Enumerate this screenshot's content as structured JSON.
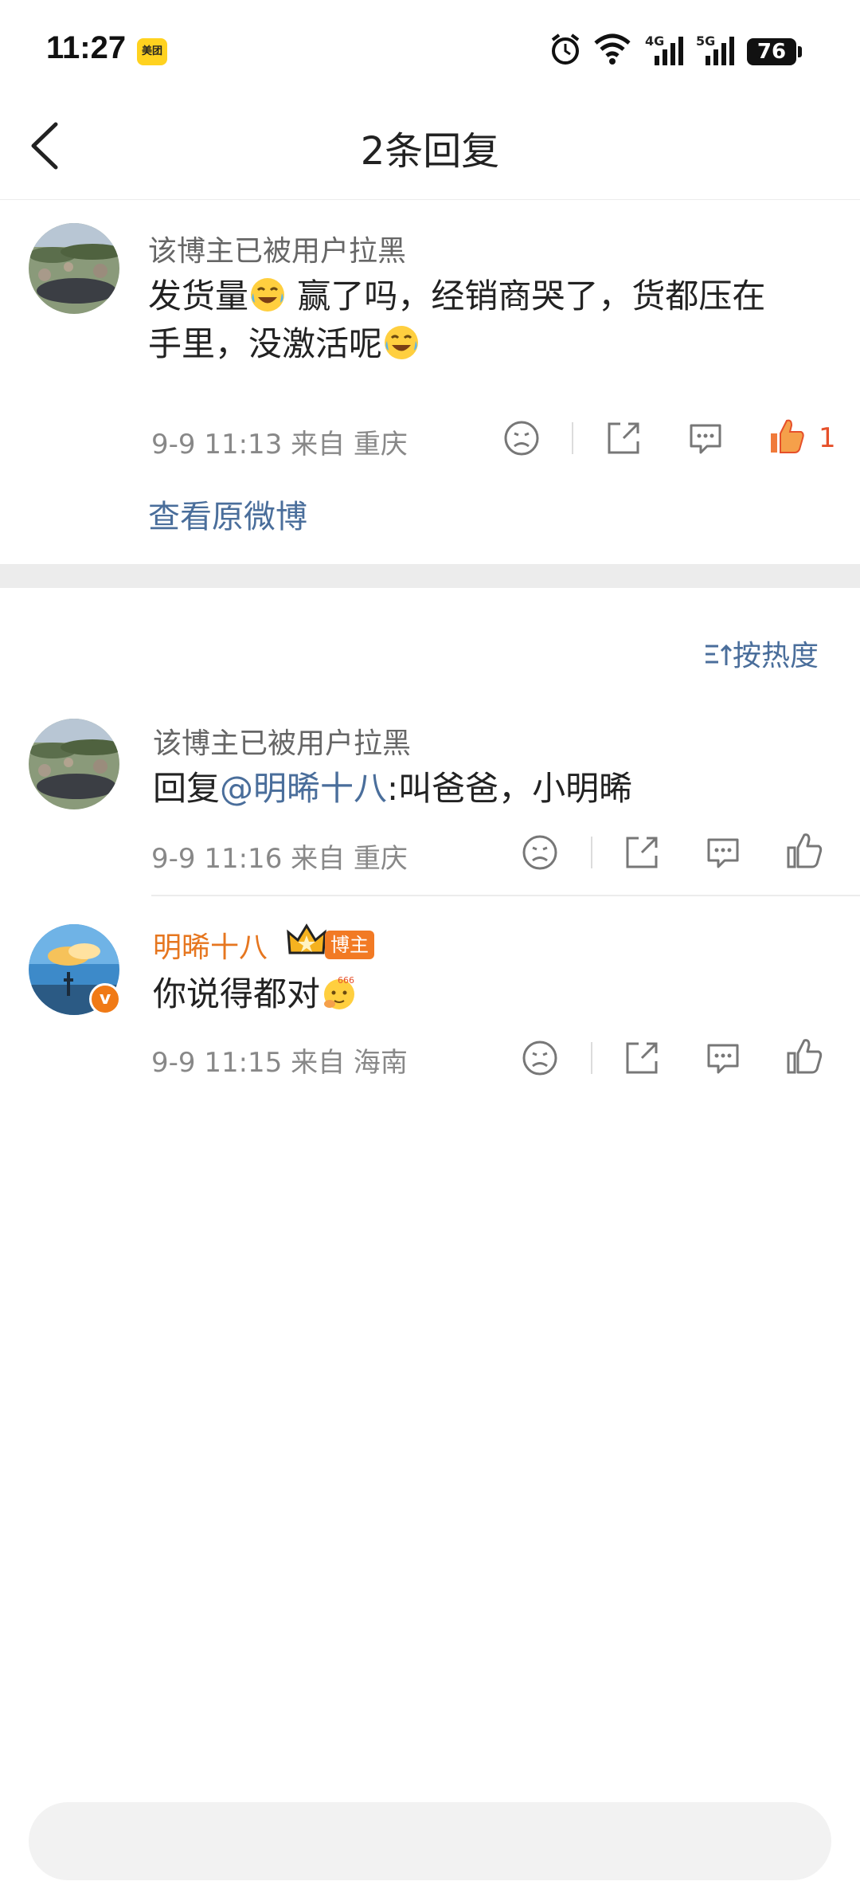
{
  "status_bar": {
    "time": "11:27",
    "meituan_badge": "美团",
    "network_4g": "4G",
    "network_5g": "5G",
    "battery": "76"
  },
  "header": {
    "title": "2条回复"
  },
  "original_comment": {
    "username": "该博主已被用户拉黑",
    "text_part1": "发货量",
    "text_part2": " 赢了吗，经销商哭了，货都压在",
    "text_part3": "手里，没激活呢",
    "time_location": "9-9 11:13  来自 重庆",
    "like_count": "1",
    "view_original": "查看原微博"
  },
  "sort": {
    "label": "按热度"
  },
  "replies": [
    {
      "username": "该博主已被用户拉黑",
      "reply_prefix": "回复",
      "mention": "@明晞十八",
      "reply_text": ":叫爸爸，小明晞",
      "time_location": "9-9 11:16  来自 重庆"
    },
    {
      "username": "明晞十八",
      "badge": "博主",
      "verified": "v",
      "text": "你说得都对",
      "time_location": "9-9 11:15  来自 海南"
    }
  ],
  "colors": {
    "link": "#4a6e9b",
    "orange": "#e6761f",
    "like": "#e6502a"
  }
}
